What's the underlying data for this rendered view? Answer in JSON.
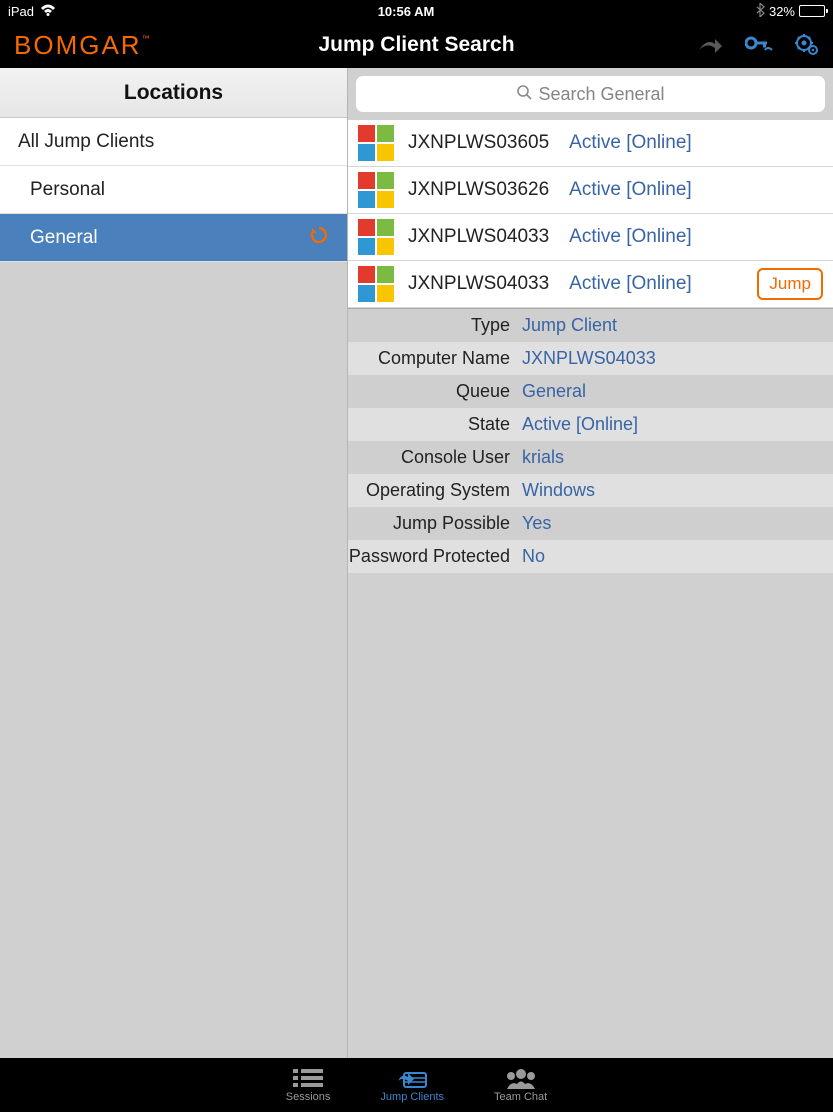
{
  "statusbar": {
    "device": "iPad",
    "time": "10:56 AM",
    "battery_pct": "32%"
  },
  "nav": {
    "brand": "BOMGAR",
    "title": "Jump Client Search"
  },
  "sidebar": {
    "header": "Locations",
    "items": [
      {
        "label": "All Jump Clients"
      },
      {
        "label": "Personal"
      },
      {
        "label": "General"
      }
    ]
  },
  "search": {
    "placeholder": "Search General"
  },
  "clients": [
    {
      "name": "JXNPLWS03605",
      "status": "Active [Online]"
    },
    {
      "name": "JXNPLWS03626",
      "status": "Active [Online]"
    },
    {
      "name": "JXNPLWS04033",
      "status": "Active [Online]"
    },
    {
      "name": "JXNPLWS04033",
      "status": "Active [Online]",
      "jump": "Jump"
    }
  ],
  "details": [
    {
      "label": "Type",
      "value": "Jump Client"
    },
    {
      "label": "Computer Name",
      "value": "JXNPLWS04033"
    },
    {
      "label": "Queue",
      "value": "General"
    },
    {
      "label": "State",
      "value": "Active [Online]"
    },
    {
      "label": "Console User",
      "value": "krials"
    },
    {
      "label": "Operating System",
      "value": "Windows"
    },
    {
      "label": "Jump Possible",
      "value": "Yes"
    },
    {
      "label": "Password Protected",
      "value": "No"
    }
  ],
  "tabs": [
    {
      "label": "Sessions"
    },
    {
      "label": "Jump Clients"
    },
    {
      "label": "Team Chat"
    }
  ]
}
